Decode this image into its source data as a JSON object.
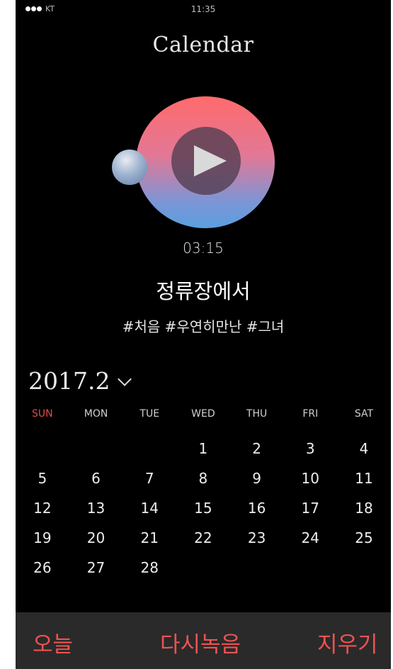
{
  "status": {
    "carrier": "KT",
    "time": "11:35"
  },
  "header": {
    "title": "Calendar"
  },
  "player": {
    "duration": "03:15",
    "song_title": "정류장에서",
    "tags": "#처음 #우연히만난 #그녀"
  },
  "calendar": {
    "month_label": "2017.2",
    "weekdays": [
      "SUN",
      "MON",
      "TUE",
      "WED",
      "THU",
      "FRI",
      "SAT"
    ],
    "weeks": [
      [
        "",
        "",
        "",
        "1",
        "2",
        "3",
        "4"
      ],
      [
        "5",
        "6",
        "7",
        "8",
        "9",
        "10",
        "11"
      ],
      [
        "12",
        "13",
        "14",
        "15",
        "16",
        "17",
        "18"
      ],
      [
        "19",
        "20",
        "21",
        "22",
        "23",
        "24",
        "25"
      ],
      [
        "26",
        "27",
        "28",
        "",
        "",
        "",
        ""
      ]
    ]
  },
  "bottom_bar": {
    "today": "오늘",
    "rerecord": "다시녹음",
    "delete": "지우기"
  },
  "colors": {
    "accent": "#ee5252",
    "sunday": "#e04a4a",
    "background": "#000000",
    "bottom_bar": "#2a2a2a"
  },
  "icons": {
    "play": "play-icon",
    "chevron": "chevron-down-icon",
    "knob": "scrubber-knob"
  }
}
